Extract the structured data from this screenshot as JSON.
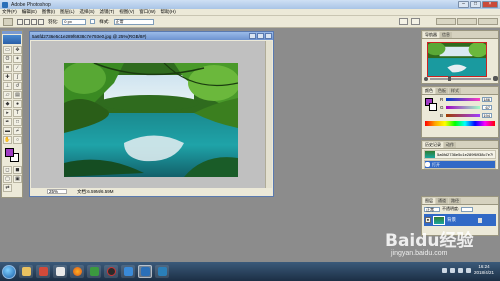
{
  "window": {
    "title": "Adobe Photoshop"
  },
  "menu": [
    "文件(F)",
    "编辑(E)",
    "图像(I)",
    "图层(L)",
    "选择(S)",
    "滤镜(T)",
    "视图(V)",
    "窗口(W)",
    "帮助(H)"
  ],
  "options": {
    "feather_label": "羽化:",
    "feather_value": "0 px",
    "style_label": "样式:",
    "style_value": "正常"
  },
  "document": {
    "title": "5a6fd2736e5c1e289f6938c7e793e0.jpg @ 25%(RGB/8#)",
    "zoom": "25%",
    "info": "文档:6.59M/6.59M"
  },
  "navigator": {
    "tabs": [
      "导航器",
      "信息"
    ]
  },
  "color": {
    "tabs": [
      "颜色",
      "色板",
      "样式"
    ],
    "rows": [
      {
        "label": "R",
        "value": "186"
      },
      {
        "label": "G",
        "value": "67"
      },
      {
        "label": "B",
        "value": "194"
      }
    ]
  },
  "history": {
    "tabs": [
      "历史记录",
      "动作"
    ],
    "items": [
      {
        "name": "5a6fd2736e5c1e289f6938c7e793e0.jpg"
      },
      {
        "name": "打开"
      }
    ]
  },
  "layers": {
    "tabs": [
      "图层",
      "通道",
      "路径"
    ],
    "mode": "正常",
    "opacity_label": "不透明度:",
    "layer_name": "背景"
  },
  "taskbar": {
    "time": "16:24",
    "date": "2018/4/21"
  },
  "watermark": {
    "main": "Baidu经验",
    "sub": "jingyan.baidu.com"
  },
  "colors": {
    "foreground": "#a03cc4",
    "background": "#ffffff",
    "accent": "#3169c6"
  }
}
